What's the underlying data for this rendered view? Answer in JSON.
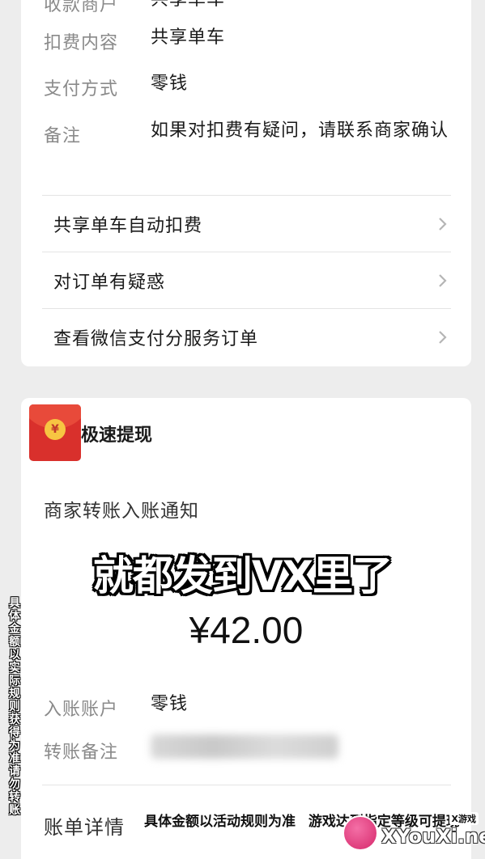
{
  "top_card": {
    "partial_row": {
      "label": "收款商户",
      "value": "共享单车"
    },
    "rows": [
      {
        "label": "扣费内容",
        "value": "共享单车"
      },
      {
        "label": "支付方式",
        "value": "零钱"
      },
      {
        "label": "备注",
        "value": "如果对扣费有疑问，请联系商家确认"
      }
    ],
    "links": [
      {
        "label": "共享单车自动扣费"
      },
      {
        "label": "对订单有疑惑"
      },
      {
        "label": "查看微信支付分服务订单"
      }
    ]
  },
  "bottom_card": {
    "badge": {
      "label": "极速提现",
      "coin_symbol": "¥"
    },
    "notice_title": "商家转账入账通知",
    "amount": "¥42.00",
    "rows": [
      {
        "label": "入账账户",
        "value": "零钱"
      },
      {
        "label": "转账备注",
        "value": ""
      }
    ],
    "bill_detail_label": "账单详情"
  },
  "overlay": {
    "headline": "就都发到VX里了",
    "vertical_caption": "具体金额以实际规则获得为准 请勿转账",
    "bottom_caption_1": "具体金额以活动规则为准",
    "bottom_caption_2": "游戏达到指定等级可提现"
  },
  "watermark": {
    "text": "XYouXi.net",
    "small": "X游戏"
  },
  "colors": {
    "background": "#ededed",
    "card": "#ffffff",
    "label_gray": "#8a8a8a",
    "red_envelope": "#d9302c",
    "coin_gold": "#f7c542"
  }
}
